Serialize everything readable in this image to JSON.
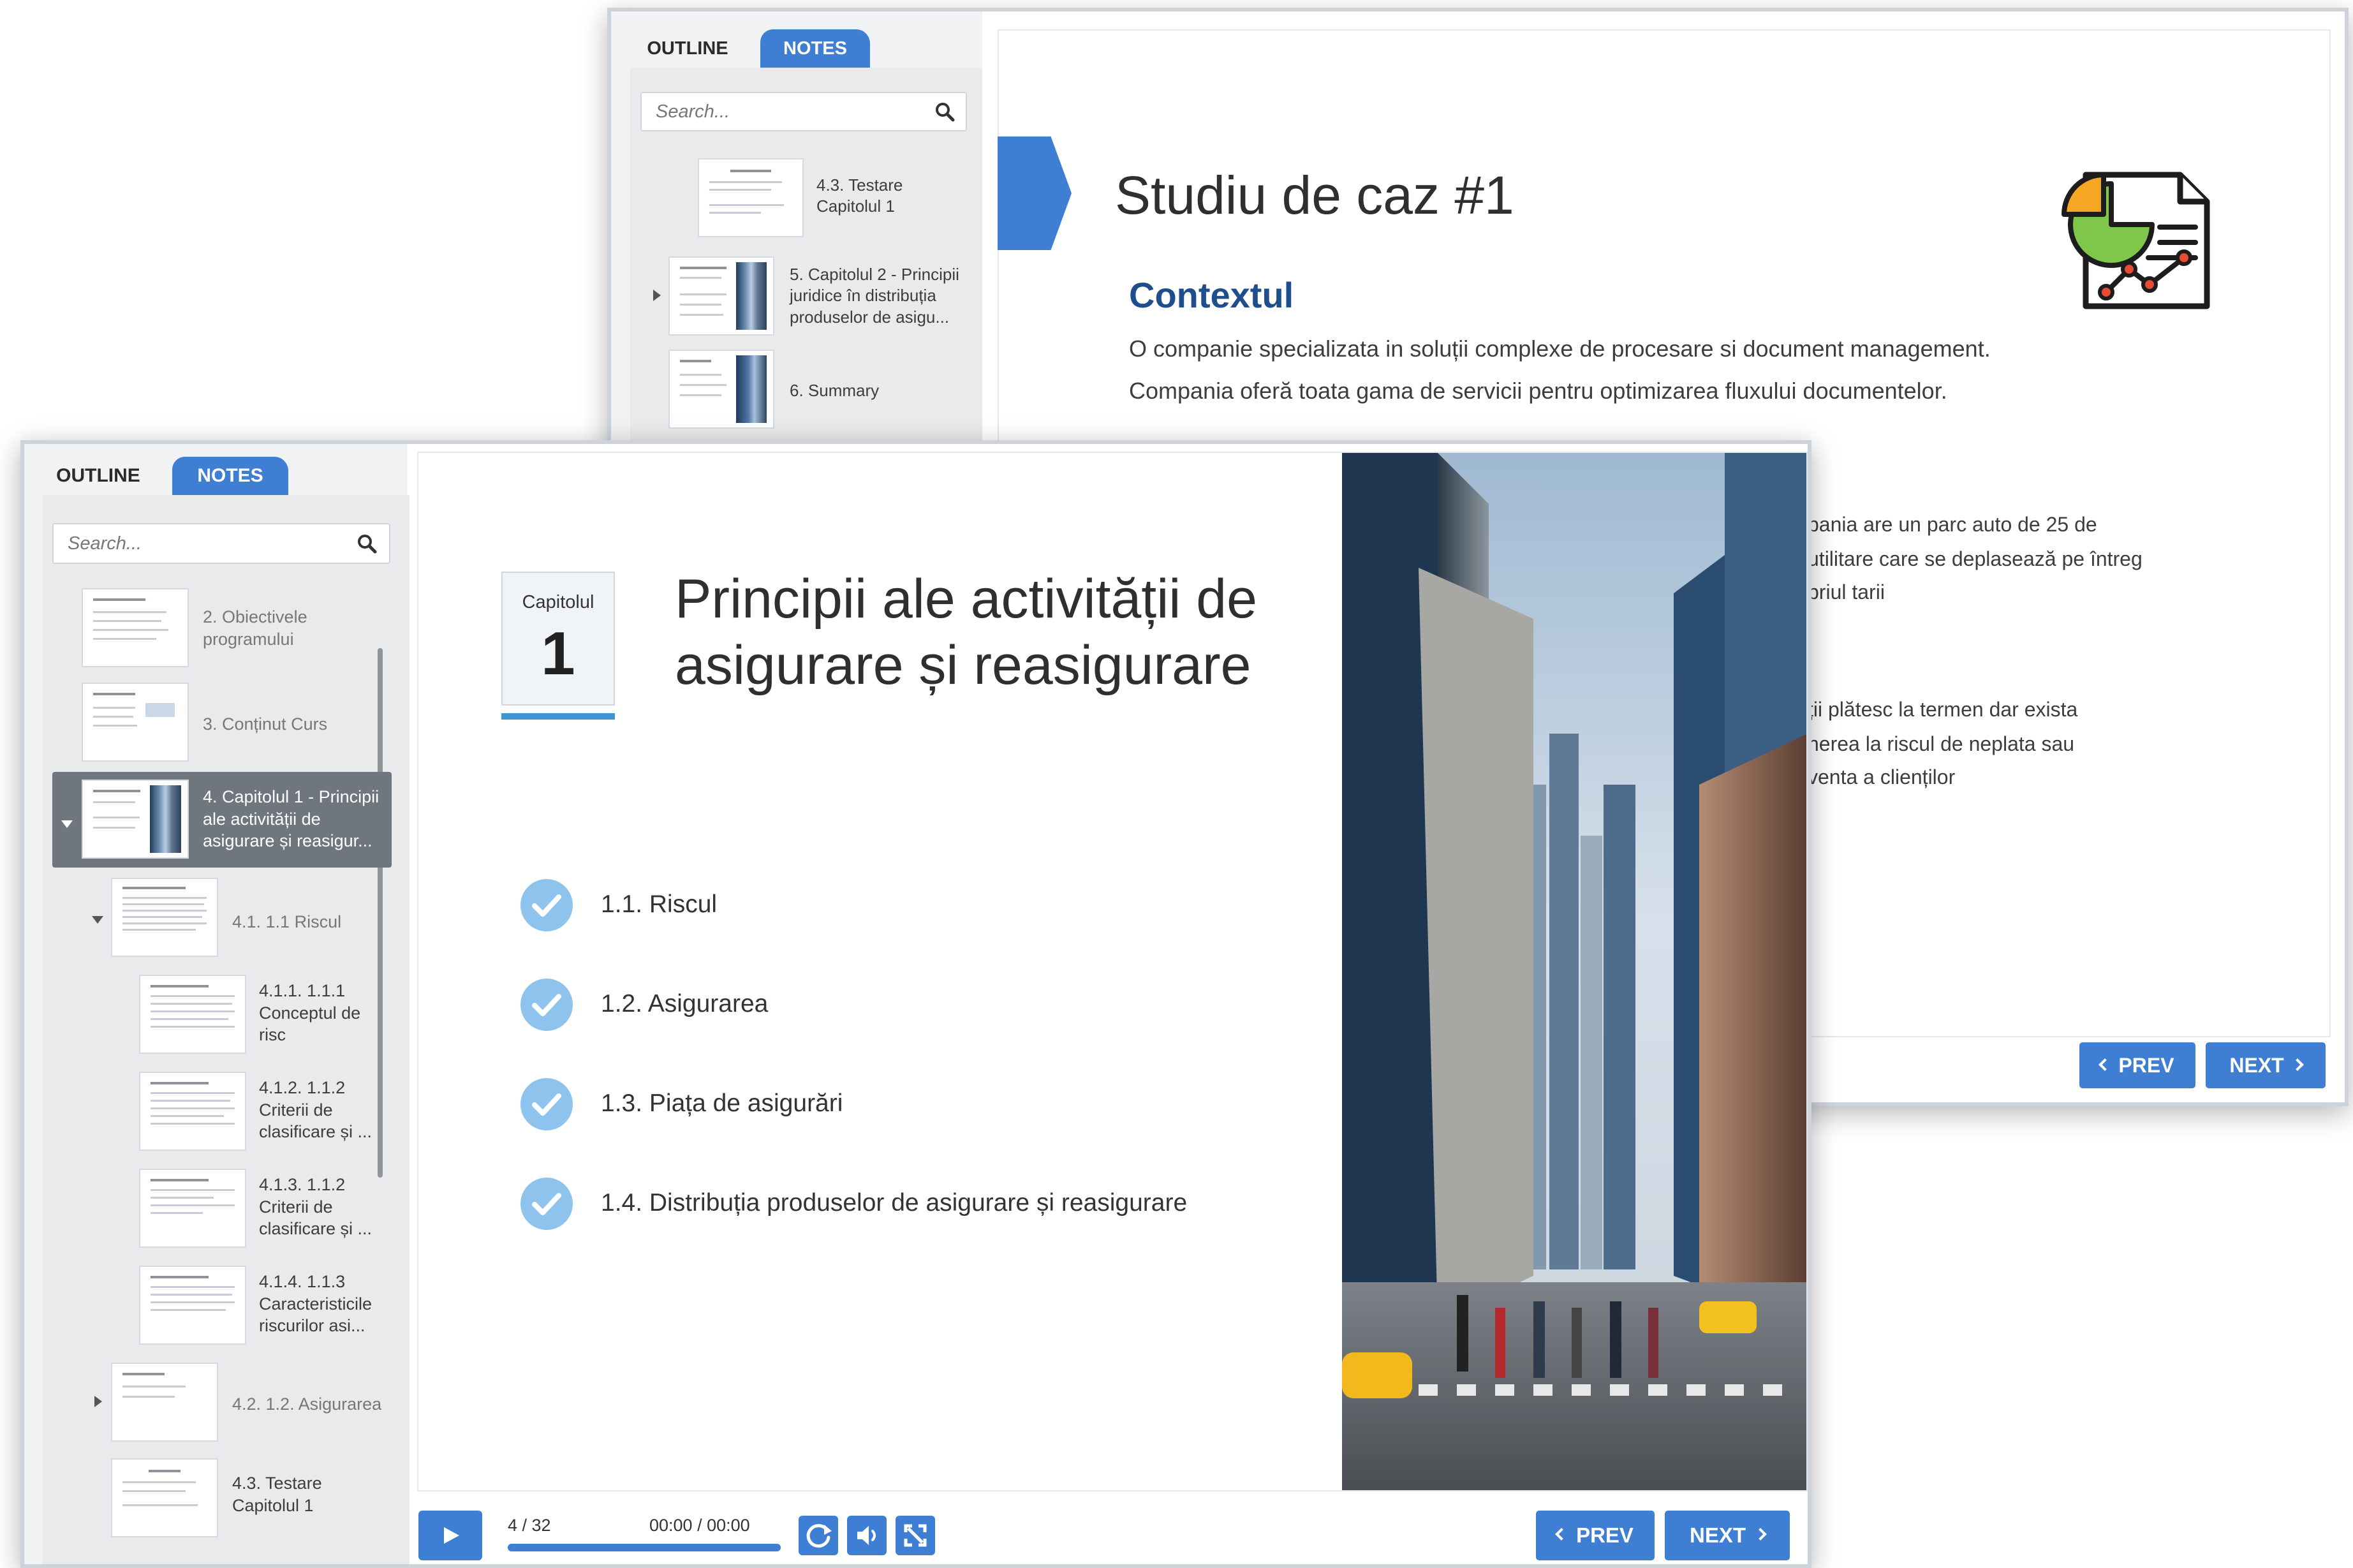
{
  "back_window": {
    "tabs": [
      "OUTLINE",
      "NOTES"
    ],
    "search_placeholder": "Search...",
    "outline_items": [
      {
        "label": "4.3. Testare Capitolul 1"
      },
      {
        "label": "5. Capitolul 2 - Principii juridice în distribuția produselor de asigu..."
      },
      {
        "label": "6. Summary"
      }
    ],
    "slide": {
      "title": "Studiu de caz #1",
      "heading": "Contextul",
      "lines": [
        "O companie specializata in soluții complexe de procesare si document management.",
        "Compania oferă toata gama de servicii pentru optimizarea fluxului documentelor."
      ],
      "cut_lines": [
        "pania are un parc auto de 25 de",
        "utilitare care se deplasează pe întreg",
        "priul tarii",
        "ții plătesc la termen dar exista",
        "nerea la riscul de neplata sau",
        "venta a clienților"
      ],
      "icon": "report-chart-icon"
    },
    "prev_label": "PREV",
    "next_label": "NEXT"
  },
  "front_window": {
    "tabs": [
      "OUTLINE",
      "NOTES"
    ],
    "search_placeholder": "Search...",
    "outline_items": [
      {
        "label": "2. Obiectivele programului"
      },
      {
        "label": "3. Conținut Curs"
      },
      {
        "label": "4. Capitolul 1 - Principii ale activității de asigurare și reasigur..."
      },
      {
        "label": "4.1. 1.1 Riscul"
      },
      {
        "label": "4.1.1. 1.1.1 Conceptul de risc"
      },
      {
        "label": "4.1.2. 1.1.2 Criterii de clasificare și ..."
      },
      {
        "label": "4.1.3. 1.1.2 Criterii de clasificare și ..."
      },
      {
        "label": "4.1.4. 1.1.3 Caracteristicile riscurilor asi..."
      },
      {
        "label": "4.2. 1.2. Asigurarea"
      },
      {
        "label": "4.3. Testare Capitolul 1"
      }
    ],
    "slide": {
      "chapter_label": "Capitolul",
      "chapter_number": "1",
      "title_line1": "Principii ale activității de",
      "title_line2": "asigurare și reasigurare",
      "topics": [
        "1.1. Riscul",
        "1.2. Asigurarea",
        "1.3. Piața de asigurări",
        "1.4. Distribuția produselor de asigurare și reasigurare"
      ],
      "photo": "city-street-photo"
    },
    "player": {
      "slide_counter": "4 / 32",
      "time": "00:00 / 00:00",
      "progress": 1.0
    },
    "prev_label": "PREV",
    "next_label": "NEXT"
  },
  "colors": {
    "accent": "#3f7fd3",
    "heading_blue": "#1f4e8c",
    "sidebar_bg": "#f1f2f4",
    "selected_item": "#6f767d",
    "check": "#8dc3ec"
  }
}
